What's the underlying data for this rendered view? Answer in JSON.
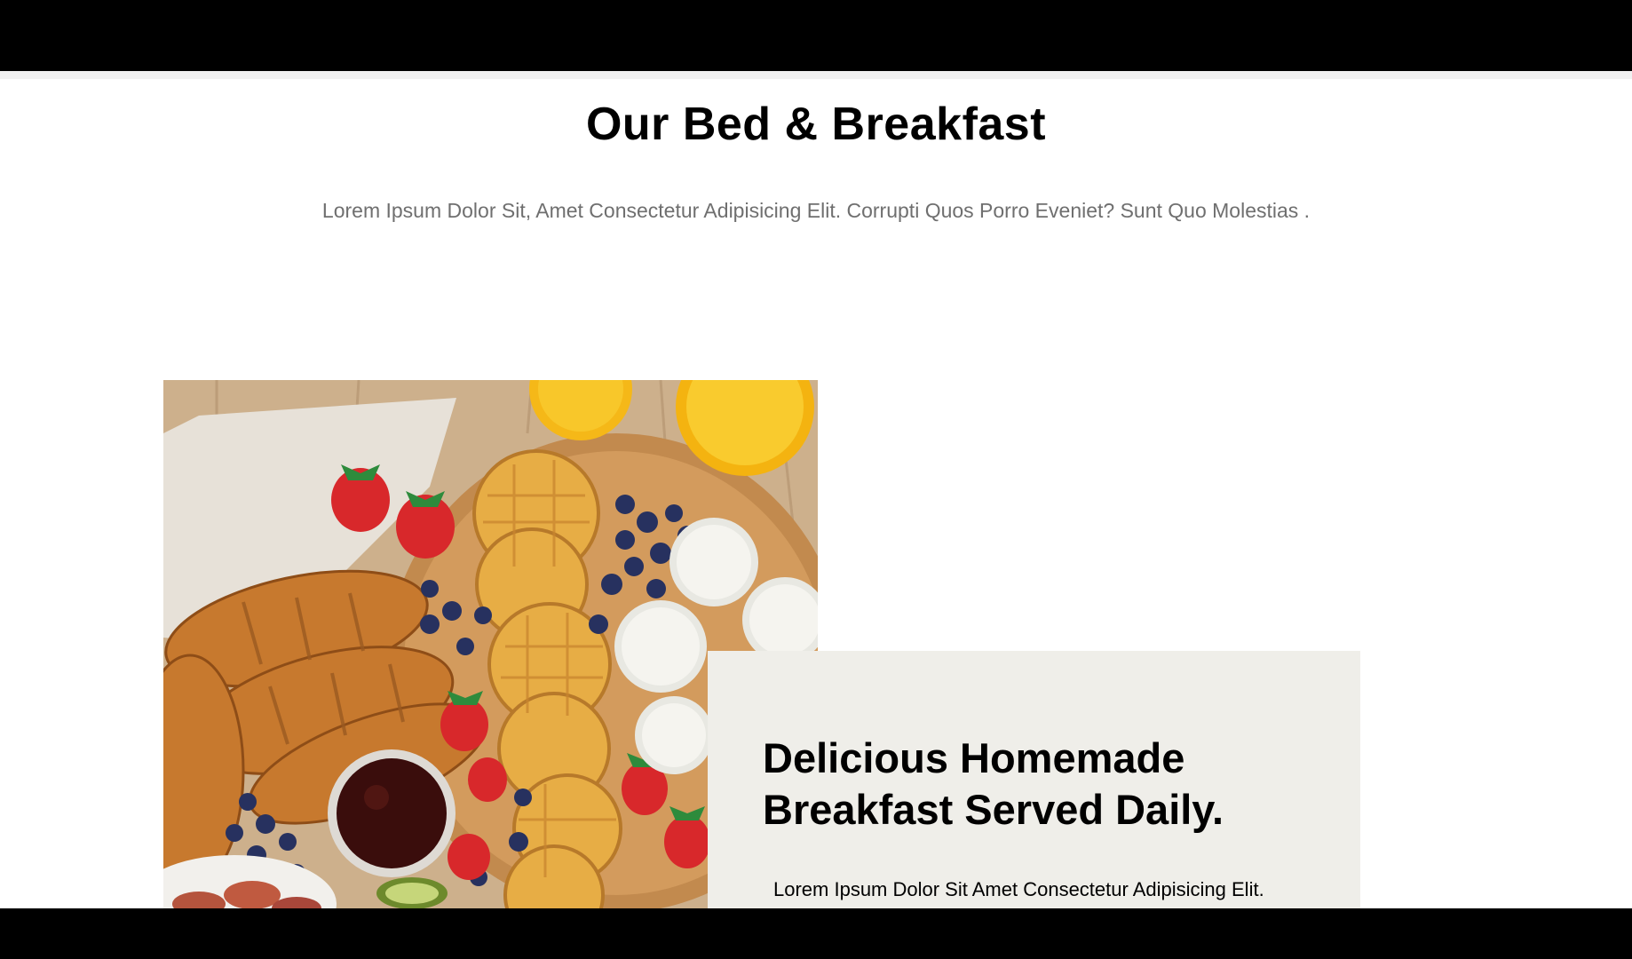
{
  "section": {
    "title": "Our Bed & Breakfast",
    "subtitle": "Lorem Ipsum Dolor Sit, Amet Consectetur Adipisicing Elit. Corrupti Quos Porro Eveniet? Sunt Quo Molestias ."
  },
  "feature": {
    "image_icon": "breakfast-photo",
    "heading_line1": "Delicious Homemade",
    "heading_line2": "Breakfast Served Daily.",
    "text": "Lorem Ipsum Dolor Sit Amet Consectetur Adipisicing Elit."
  },
  "colors": {
    "card_background": "#efeee9",
    "subtitle": "#6f6f6f",
    "bars": "#000000"
  }
}
